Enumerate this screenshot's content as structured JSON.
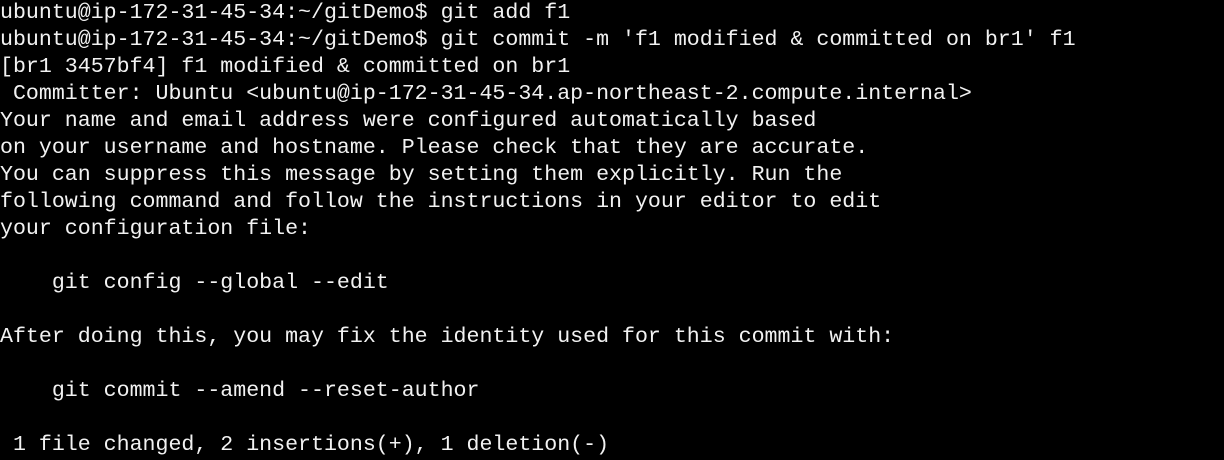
{
  "terminal": {
    "background": "#000000",
    "foreground": "#f2f2f2",
    "lines": [
      "ubuntu@ip-172-31-45-34:~/gitDemo$ git add f1",
      "ubuntu@ip-172-31-45-34:~/gitDemo$ git commit -m 'f1 modified & committed on br1' f1",
      "[br1 3457bf4] f1 modified & committed on br1",
      " Committer: Ubuntu <ubuntu@ip-172-31-45-34.ap-northeast-2.compute.internal>",
      "Your name and email address were configured automatically based",
      "on your username and hostname. Please check that they are accurate.",
      "You can suppress this message by setting them explicitly. Run the",
      "following command and follow the instructions in your editor to edit",
      "your configuration file:",
      "",
      "    git config --global --edit",
      "",
      "After doing this, you may fix the identity used for this commit with:",
      "",
      "    git commit --amend --reset-author",
      "",
      " 1 file changed, 2 insertions(+), 1 deletion(-)"
    ]
  }
}
